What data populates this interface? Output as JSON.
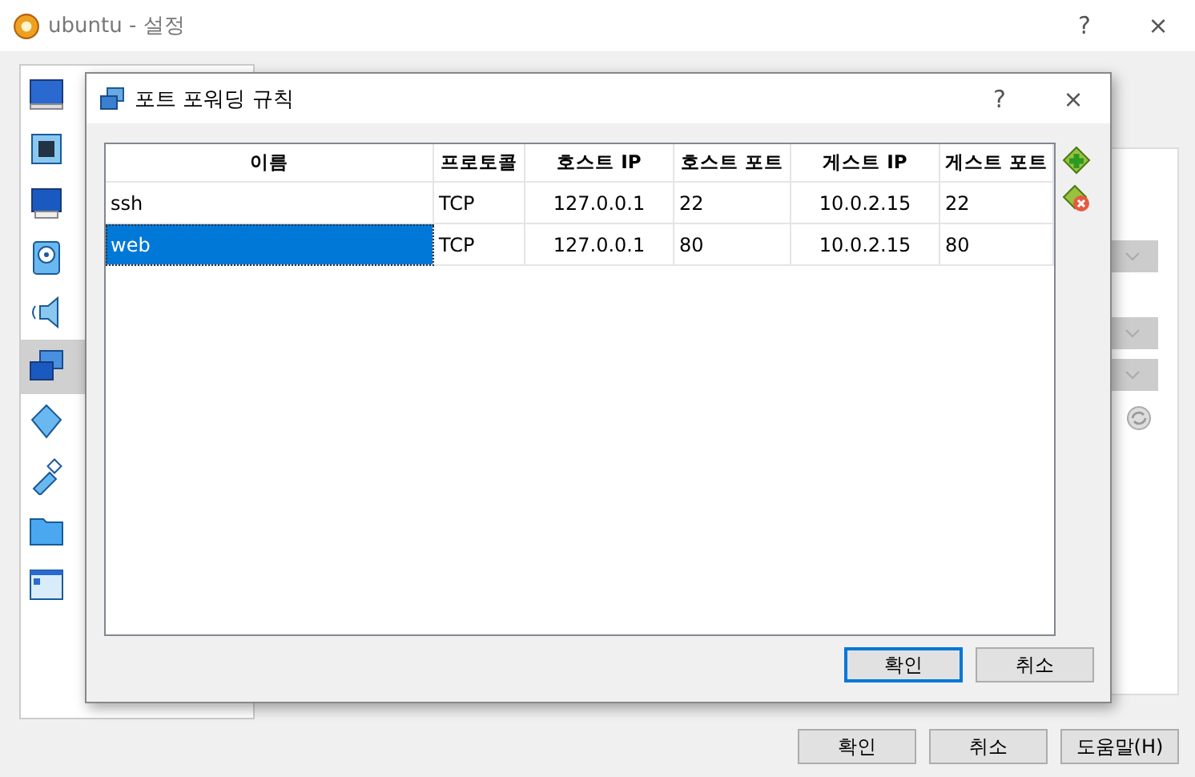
{
  "window": {
    "title": "ubuntu - 설정",
    "help": "?",
    "close": "×"
  },
  "sidebar": {
    "items": [
      {
        "kind": "general",
        "selected": false
      },
      {
        "kind": "system",
        "selected": false
      },
      {
        "kind": "display",
        "selected": false
      },
      {
        "kind": "storage",
        "selected": false
      },
      {
        "kind": "audio",
        "selected": false
      },
      {
        "kind": "network",
        "selected": true
      },
      {
        "kind": "serial",
        "selected": false
      },
      {
        "kind": "usb",
        "selected": false
      },
      {
        "kind": "folder",
        "selected": false
      },
      {
        "kind": "interface",
        "selected": false
      }
    ]
  },
  "buttons": [
    {
      "label": "확인"
    },
    {
      "label": "취소"
    },
    {
      "label": "도움말(H)"
    }
  ],
  "dialog": {
    "title": "포트 포워딩 규칙",
    "help": "?",
    "close": "×",
    "table": {
      "columns": [
        "이름",
        "프로토콜",
        "호스트 IP",
        "호스트 포트",
        "게스트 IP",
        "게스트 포트"
      ],
      "rows": [
        {
          "cells": [
            "ssh",
            "TCP",
            "127.0.0.1",
            "22",
            "10.0.2.15",
            "22"
          ],
          "selected": false
        },
        {
          "cells": [
            "web",
            "TCP",
            "127.0.0.1",
            "80",
            "10.0.2.15",
            "80"
          ],
          "selected": true
        }
      ]
    },
    "buttons": [
      {
        "label": "확인",
        "focused": true
      },
      {
        "label": "취소",
        "focused": false
      }
    ]
  }
}
